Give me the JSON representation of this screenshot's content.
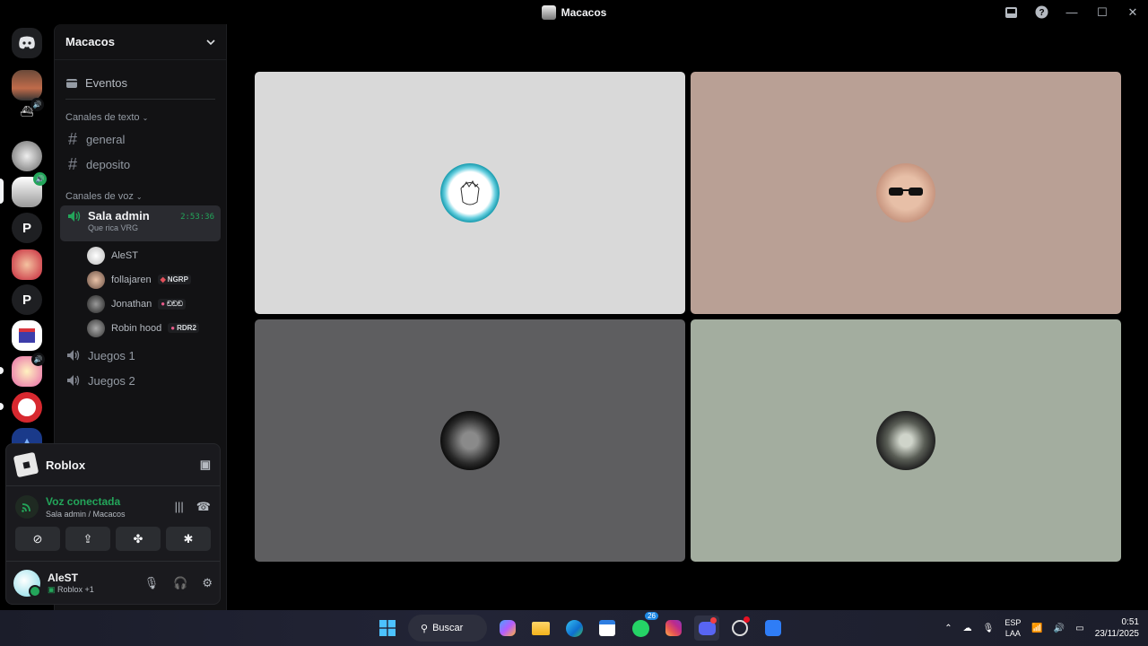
{
  "window": {
    "title": "Macacos"
  },
  "server": {
    "name": "Macacos",
    "events_label": "Eventos",
    "text_category": "Canales de texto",
    "text_channels": [
      "general",
      "deposito"
    ],
    "voice_category": "Canales de voz",
    "voice_active": {
      "name": "Sala admin",
      "timer": "2:53:36",
      "status": "Que rica VRG"
    },
    "members": [
      {
        "name": "AleST",
        "tag": ""
      },
      {
        "name": "follajaren",
        "tag": "NGRP"
      },
      {
        "name": "Jonathan",
        "tag": "ඞඞඞ"
      },
      {
        "name": "Robin hood",
        "tag": "RDR2"
      }
    ],
    "voice_channels": [
      "Juegos 1",
      "Juegos 2"
    ]
  },
  "rail": {
    "letters": [
      "P",
      "P"
    ]
  },
  "panel": {
    "activity": "Roblox",
    "voice_status": "Voz conectada",
    "voice_location": "Sala admin / Macacos",
    "user": {
      "name": "AleST",
      "status": "Roblox +1"
    }
  },
  "tiles": [
    {
      "bg": "#d9d9d9"
    },
    {
      "bg": "#b9a095"
    },
    {
      "bg": "#5e5e60"
    },
    {
      "bg": "#a3ad9f"
    }
  ],
  "taskbar": {
    "search": "Buscar",
    "whatsapp_badge": "26",
    "lang_top": "ESP",
    "lang_bottom": "LAA",
    "time": "0:51",
    "date": "23/11/2025"
  },
  "colors": {
    "green": "#23a55a",
    "accent": "#5865f2"
  }
}
